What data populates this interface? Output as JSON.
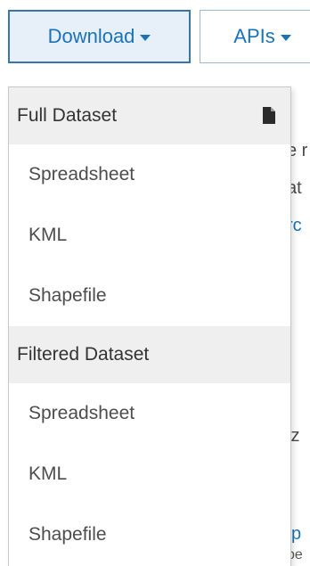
{
  "toolbar": {
    "download_label": "Download",
    "apis_label": "APIs"
  },
  "menu": {
    "full_dataset": {
      "header": "Full Dataset",
      "icon": "file-icon",
      "items": [
        "Spreadsheet",
        "KML",
        "Shapefile"
      ]
    },
    "filtered_dataset": {
      "header": "Filtered Dataset",
      "items": [
        "Spreadsheet",
        "KML",
        "Shapefile"
      ]
    }
  },
  "background": {
    "fragments": [
      "e r",
      "at",
      "rc",
      "iz",
      "p",
      "pe"
    ]
  },
  "colors": {
    "accent": "#1a73b8",
    "active_button_bg": "#e7f0f8",
    "active_button_border": "#3a74a8",
    "menu_header_bg": "#efefef",
    "menu_text": "#4d4d4d"
  }
}
